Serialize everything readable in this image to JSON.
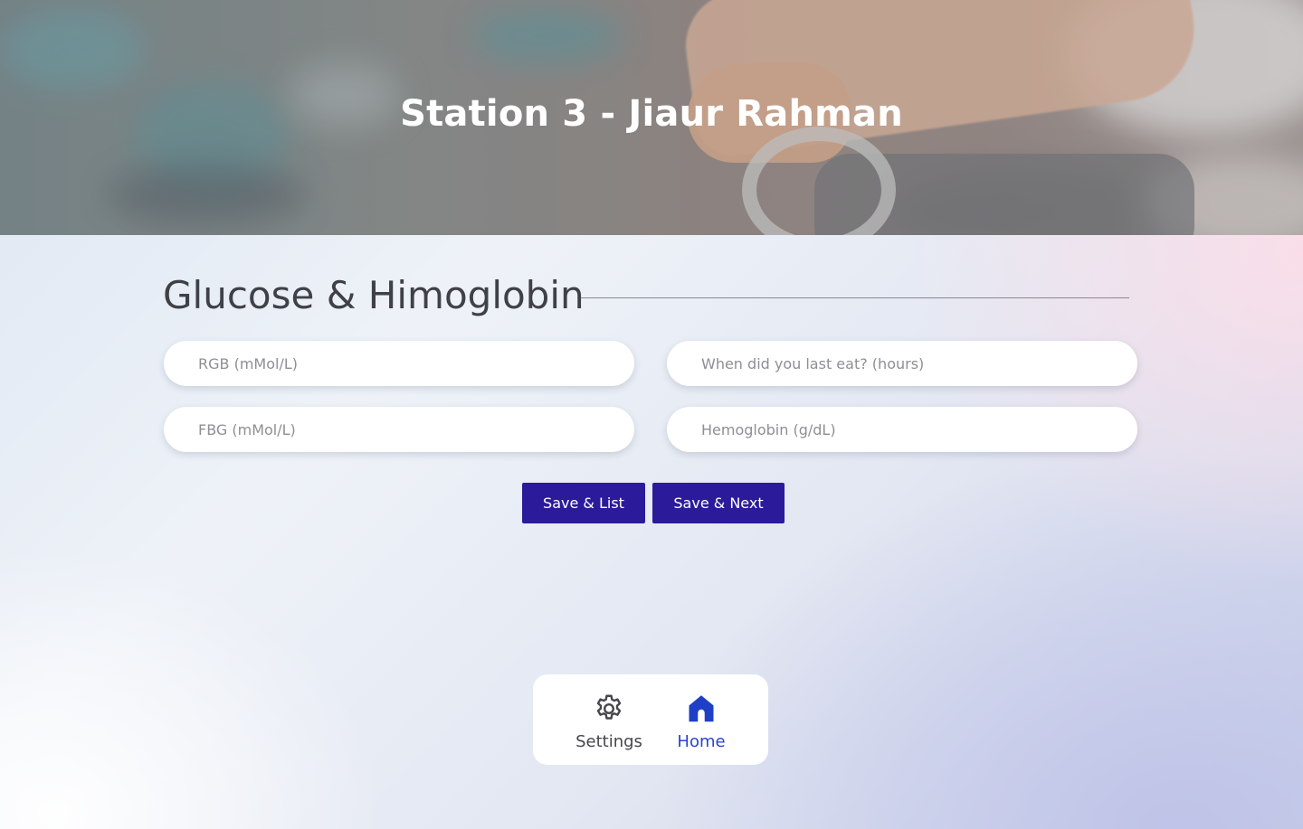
{
  "header": {
    "title": "Station 3 - Jiaur Rahman"
  },
  "section": {
    "title": "Glucose & Himoglobin"
  },
  "form": {
    "rgb": {
      "placeholder": "RGB (mMol/L)",
      "value": ""
    },
    "last_eat": {
      "placeholder": "When did you last eat? (hours)",
      "value": ""
    },
    "fbg": {
      "placeholder": "FBG (mMol/L)",
      "value": ""
    },
    "hemoglobin": {
      "placeholder": "Hemoglobin (g/dL)",
      "value": ""
    }
  },
  "actions": {
    "save_list": "Save & List",
    "save_next": "Save & Next"
  },
  "nav": {
    "settings": {
      "label": "Settings",
      "icon": "gear-icon"
    },
    "home": {
      "label": "Home",
      "icon": "home-icon",
      "active": true
    }
  },
  "colors": {
    "primary_button": "#2b1b9b",
    "active_nav": "#2a45c8"
  }
}
